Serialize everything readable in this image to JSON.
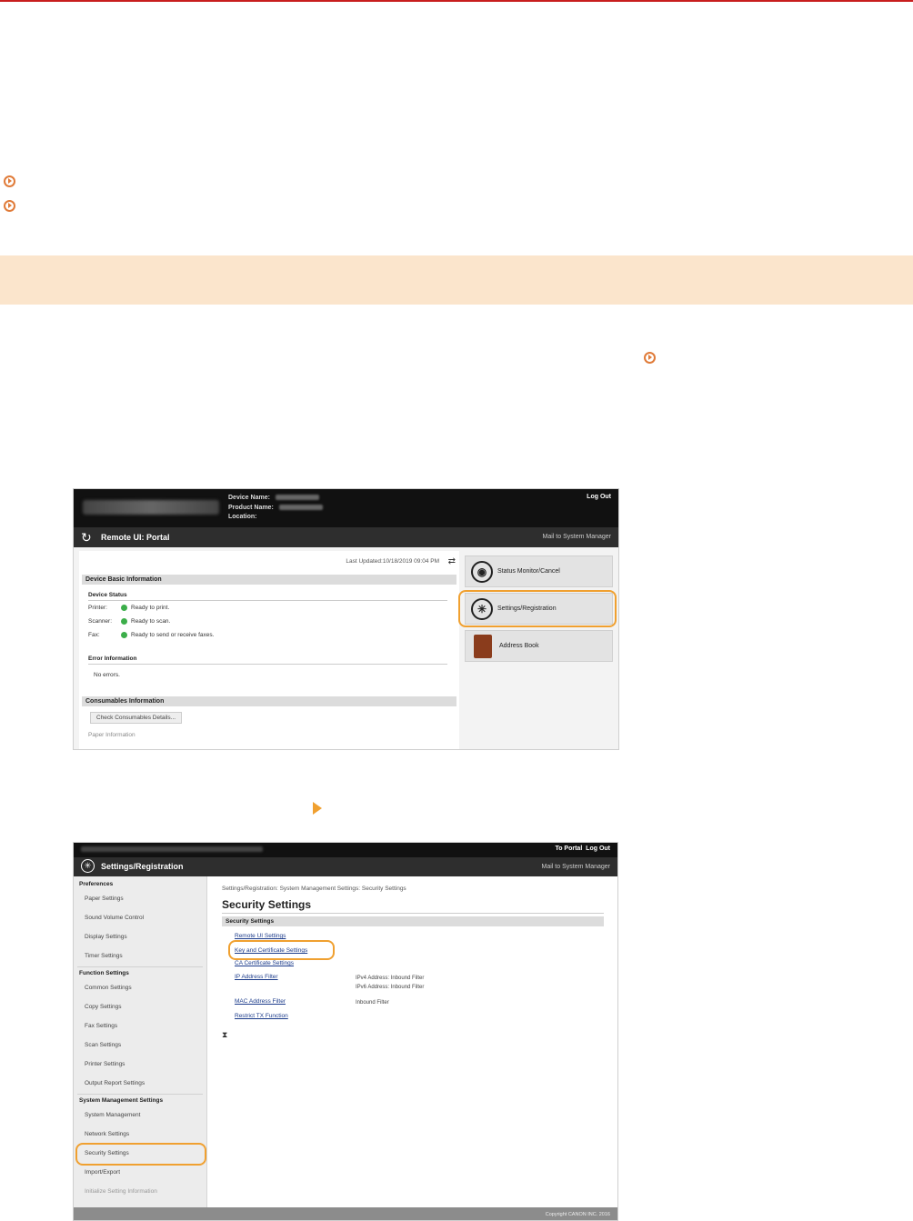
{
  "shot1": {
    "device_name_label": "Device Name:",
    "product_name_label": "Product Name:",
    "location_label": "Location:",
    "logout": "Log Out",
    "portal_title": "Remote UI: Portal",
    "mail_link": "Mail to System Manager",
    "last_updated": "Last Updated:10/18/2019 09:04 PM",
    "device_basic_info": "Device Basic Information",
    "device_status": "Device Status",
    "status_rows": [
      {
        "label": "Printer:",
        "value": "Ready to print."
      },
      {
        "label": "Scanner:",
        "value": "Ready to scan."
      },
      {
        "label": "Fax:",
        "value": "Ready to send or receive faxes."
      }
    ],
    "error_information": "Error Information",
    "no_errors": "No errors.",
    "consumables_information": "Consumables Information",
    "check_consumables": "Check Consumables Details...",
    "paper_information": "Paper Information",
    "tiles": {
      "status_monitor": "Status Monitor/Cancel",
      "settings_registration": "Settings/Registration",
      "address_book": "Address Book"
    }
  },
  "shot2": {
    "to_portal": "To Portal",
    "logout": "Log Out",
    "title": "Settings/Registration",
    "mail_link": "Mail to System Manager",
    "nav": {
      "preferences": "Preferences",
      "paper_settings": "Paper Settings",
      "sound_volume": "Sound Volume Control",
      "display_settings": "Display Settings",
      "timer_settings": "Timer Settings",
      "function_settings": "Function Settings",
      "common_settings": "Common Settings",
      "copy_settings": "Copy Settings",
      "fax_settings": "Fax Settings",
      "scan_settings": "Scan Settings",
      "printer_settings": "Printer Settings",
      "output_report": "Output Report Settings",
      "system_management_settings": "System Management Settings",
      "system_management": "System Management",
      "network_settings": "Network Settings",
      "security_settings": "Security Settings",
      "import_export": "Import/Export",
      "initialize": "Initialize Setting Information"
    },
    "breadcrumb": "Settings/Registration: System Management Settings: Security Settings",
    "page_title": "Security Settings",
    "section": "Security Settings",
    "links": {
      "remote_ui": "Remote UI Settings",
      "key_cert": "Key and Certificate Settings",
      "ca_cert": "CA Certificate Settings",
      "ip_filter": "IP Address Filter",
      "mac_filter": "MAC Address Filter",
      "restrict_tx": "Restrict TX Function"
    },
    "notes": {
      "ipv4": "IPv4 Address: Inbound Filter",
      "ipv6": "IPv6 Address: Inbound Filter",
      "inbound": "Inbound Filter"
    },
    "copyright": "Copyright CANON INC. 2016"
  },
  "colors": {
    "accent_orange": "#f0a030",
    "section_band": "#fbe5cc",
    "top_rule": "#c81e1e"
  }
}
